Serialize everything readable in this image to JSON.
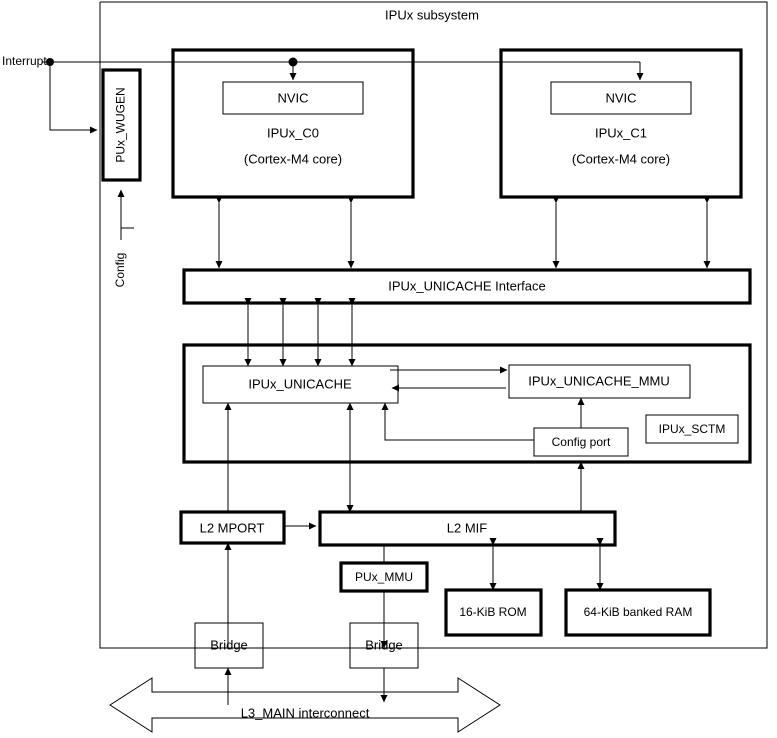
{
  "diagram": {
    "title": "IPUx subsystem",
    "external_labels": {
      "interrupts": "Interrupts",
      "config": "Config"
    },
    "colors": {
      "core_fill": "#F0EC7E",
      "nvic_fill": "#D4AC13",
      "bridge_fill": "#12B08C",
      "outline": "#000000",
      "background": "#FFFFFF"
    },
    "blocks": {
      "wugen": "PUx_WUGEN",
      "core0_name": "IPUx_C0",
      "core0_sub": "(Cortex-M4 core)",
      "core0_nvic": "NVIC",
      "core1_name": "IPUx_C1",
      "core1_sub": "(Cortex-M4 core)",
      "core1_nvic": "NVIC",
      "unicache_interface": "IPUx_UNICACHE Interface",
      "unicache": "IPUx_UNICACHE",
      "unicache_mmu": "IPUx_UNICACHE_MMU",
      "sctm": "IPUx_SCTM",
      "config_port": "Config port",
      "l2_mport": "L2 MPORT",
      "l2_mif": "L2 MIF",
      "pux_mmu": "PUx_MMU",
      "rom": "16-KiB ROM",
      "ram": "64-KiB banked RAM",
      "bridge_left": "Bridge",
      "bridge_right": "Bridge",
      "l3_interconnect": "L3_MAIN interconnect"
    }
  }
}
